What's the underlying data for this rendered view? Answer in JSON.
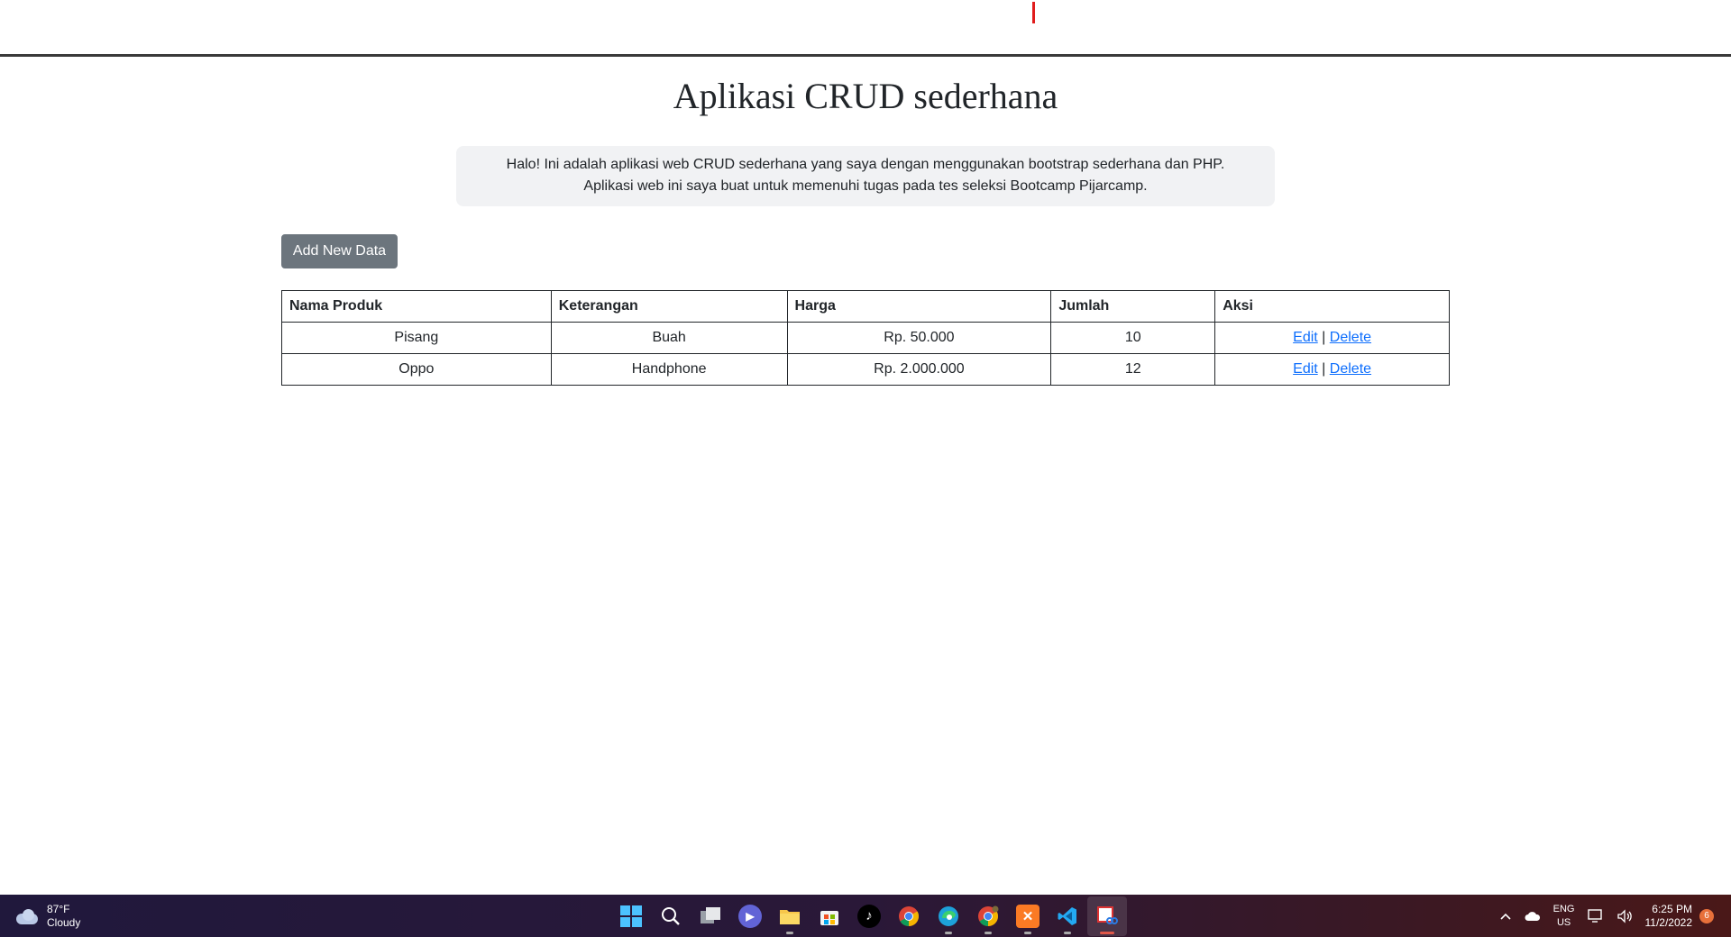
{
  "page": {
    "title": "Aplikasi CRUD sederhana",
    "intro_line1": "Halo! Ini adalah aplikasi web CRUD sederhana yang saya dengan menggunakan bootstrap sederhana dan PHP.",
    "intro_line2": "Aplikasi web ini saya buat untuk memenuhi tugas pada tes seleksi Bootcamp Pijarcamp.",
    "add_button_label": "Add New Data"
  },
  "table": {
    "headers": [
      "Nama Produk",
      "Keterangan",
      "Harga",
      "Jumlah",
      "Aksi"
    ],
    "rows": [
      {
        "nama": "Pisang",
        "keterangan": "Buah",
        "harga": "Rp. 50.000",
        "jumlah": "10",
        "edit": "Edit",
        "sep": "|",
        "delete": "Delete"
      },
      {
        "nama": "Oppo",
        "keterangan": "Handphone",
        "harga": "Rp. 2.000.000",
        "jumlah": "12",
        "edit": "Edit",
        "sep": "|",
        "delete": "Delete"
      }
    ]
  },
  "taskbar": {
    "weather_temp": "87°F",
    "weather_desc": "Cloudy",
    "icons": [
      "start-icon",
      "search-icon",
      "task-view-icon",
      "chat-icon",
      "file-explorer-icon",
      "store-icon",
      "tiktok-icon",
      "chrome-icon",
      "edge-icon",
      "chrome-dev-icon",
      "xampp-icon",
      "vscode-icon",
      "snipping-tool-icon"
    ],
    "lang_line1": "ENG",
    "lang_line2": "US",
    "time": "6:25 PM",
    "date": "11/2/2022",
    "notification_count": "6"
  },
  "colors": {
    "button_bg": "#6c757d",
    "link": "#0d6efd",
    "intro_bg": "#f1f2f4",
    "accent_mark": "#e01c1c"
  }
}
